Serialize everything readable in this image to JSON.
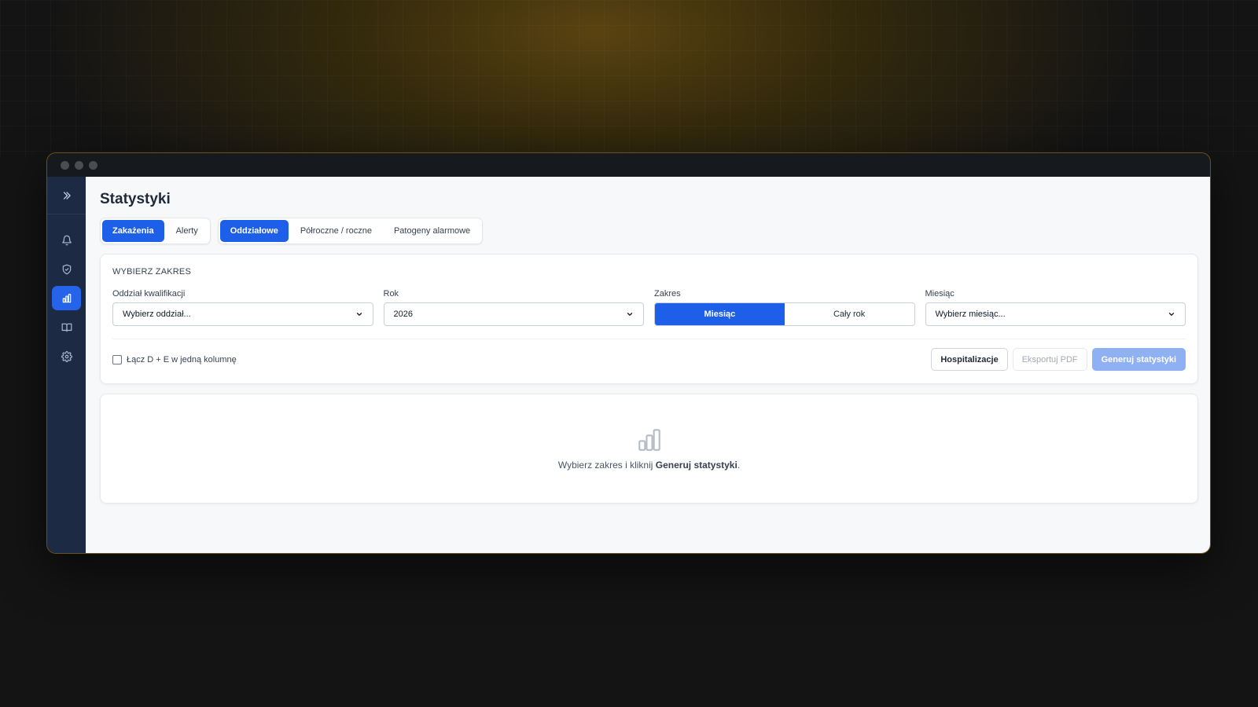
{
  "window": {
    "title_dots": [
      "close",
      "minimize",
      "maximize"
    ]
  },
  "sidebar": {
    "toggle_icon": "chevrons-right-icon",
    "items": [
      {
        "icon": "bell-icon",
        "active": false
      },
      {
        "icon": "shield-icon",
        "active": false
      },
      {
        "icon": "bar-chart-icon",
        "active": true
      },
      {
        "icon": "book-icon",
        "active": false
      },
      {
        "icon": "gear-icon",
        "active": false
      }
    ]
  },
  "page": {
    "title": "Statystyki"
  },
  "tabs": {
    "group1": [
      {
        "label": "Zakażenia",
        "active": true
      },
      {
        "label": "Alerty",
        "active": false
      }
    ],
    "group2": [
      {
        "label": "Oddziałowe",
        "active": true
      },
      {
        "label": "Półroczne / roczne",
        "active": false
      },
      {
        "label": "Patogeny alarmowe",
        "active": false
      }
    ]
  },
  "filters": {
    "section_label": "WYBIERZ ZAKRES",
    "ward": {
      "label": "Oddział kwalifikacji",
      "value": "Wybierz oddział..."
    },
    "year": {
      "label": "Rok",
      "value": "2026"
    },
    "range": {
      "label": "Zakres",
      "options": [
        "Miesiąc",
        "Cały rok"
      ],
      "selected": "Miesiąc"
    },
    "month": {
      "label": "Miesiąc",
      "value": "Wybierz miesiąc..."
    },
    "merge_checkbox": {
      "label": "Łącz D + E w jedną kolumnę",
      "checked": false
    },
    "buttons": {
      "hospitalizations": "Hospitalizacje",
      "export_pdf": "Eksportuj PDF",
      "generate": "Generuj statystyki"
    }
  },
  "empty_state": {
    "prefix": "Wybierz zakres i kliknij ",
    "bold": "Generuj statystyki",
    "suffix": "."
  },
  "colors": {
    "accent": "#1d5fe8",
    "sidebar_bg": "#1d2a44"
  }
}
